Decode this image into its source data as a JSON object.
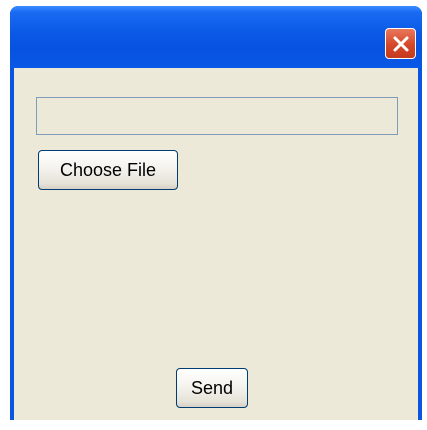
{
  "window": {
    "title": "",
    "close_icon": "close-x-icon",
    "colors": {
      "titlebar": "#0a59e6",
      "close_button": "#d6472a",
      "client_background": "#ece9d8"
    }
  },
  "form": {
    "file_path_value": "",
    "choose_file_label": "Choose File",
    "send_label": "Send"
  }
}
